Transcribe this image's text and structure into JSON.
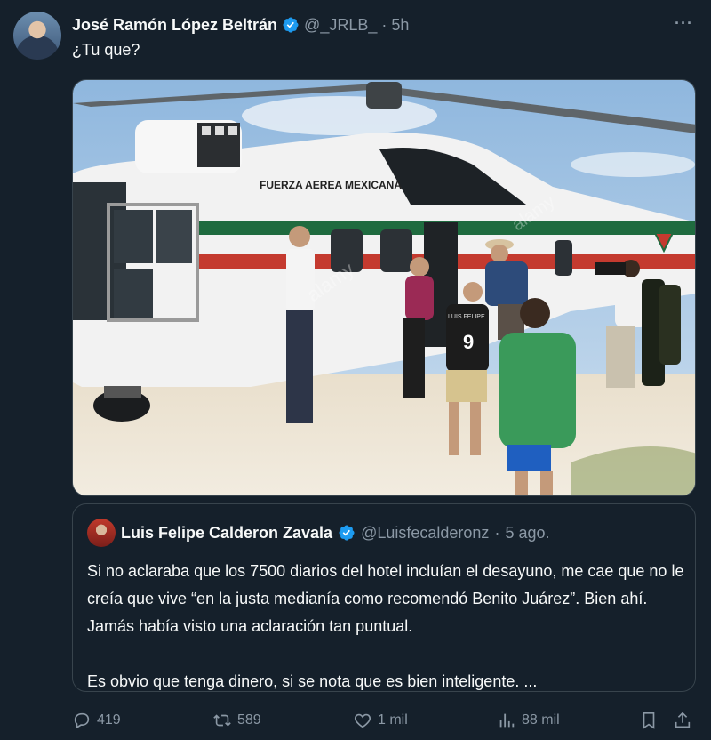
{
  "tweet": {
    "author_name": "José Ramón López Beltrán",
    "handle": "@_JRLB_",
    "separator": "·",
    "time": "5h",
    "more_label": "···",
    "text": "¿Tu que?"
  },
  "quote": {
    "author_name": "Luis Felipe Calderon Zavala",
    "handle": "@Luisfecalderonz",
    "separator": "·",
    "time": "5 ago.",
    "paragraph_1": "Si no aclaraba que los 7500 diarios del hotel incluían el desayuno, me cae que no le creía que vive “en la justa medianía como recomendó Benito Juárez”. Bien ahí. Jamás había visto una aclaración tan puntual.",
    "paragraph_2": "Es obvio que tenga dinero, si se nota que es bien inteligente. ..."
  },
  "media": {
    "helicopter_text": "FUERZA AEREA MEXICANA",
    "watermark": "alamy",
    "shirt_text": "LUIS FELIPE",
    "shirt_number": "9"
  },
  "actions": {
    "replies": "419",
    "reposts": "589",
    "likes": "1 mil",
    "views": "88 mil"
  },
  "icons": [
    "verified-badge-icon",
    "more-icon",
    "reply-icon",
    "repost-icon",
    "like-icon",
    "views-icon",
    "bookmark-icon",
    "share-icon"
  ],
  "colors": {
    "background": "#15202b",
    "text": "#f7f9f9",
    "secondary": "#8b98a5",
    "verified": "#1d9bf0",
    "border": "#38444d"
  }
}
